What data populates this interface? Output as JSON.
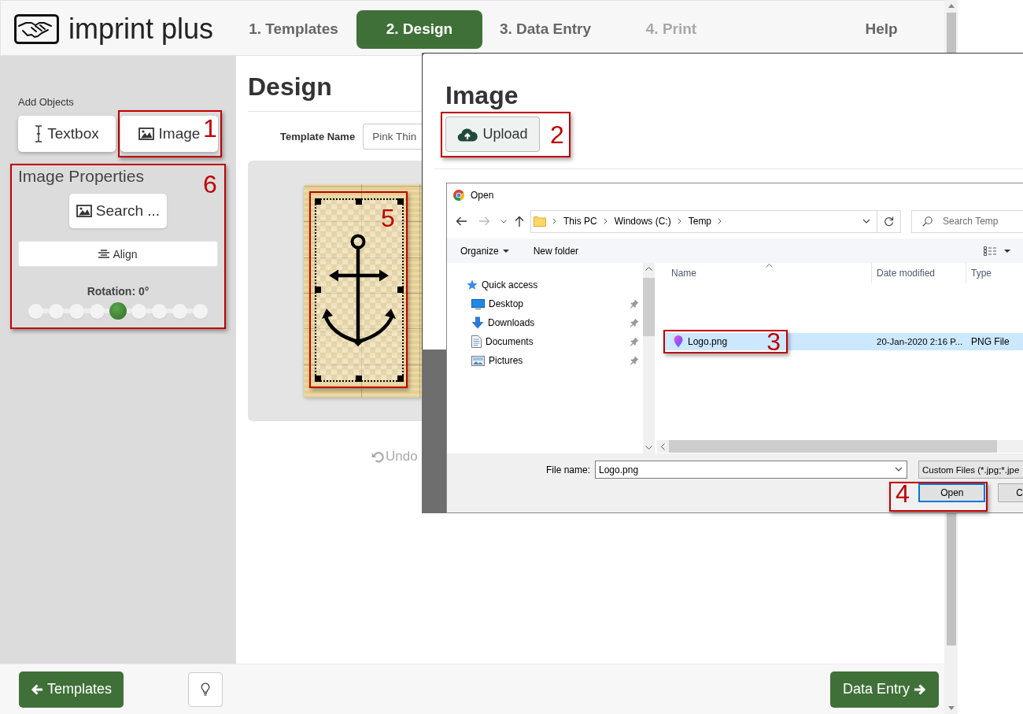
{
  "header": {
    "logo": "imprint plus",
    "steps": [
      {
        "label": "1. Templates",
        "selected": false,
        "disabled": false
      },
      {
        "label": "2. Design",
        "selected": true,
        "disabled": false
      },
      {
        "label": "3. Data Entry",
        "selected": false,
        "disabled": false
      },
      {
        "label": "4. Print",
        "selected": false,
        "disabled": true
      }
    ],
    "help": "Help"
  },
  "sidebar": {
    "add_objects": {
      "label": "Add Objects",
      "buttons": [
        {
          "kind": "textbox",
          "label": "Textbox"
        },
        {
          "kind": "image",
          "label": "Image",
          "callout": "1"
        }
      ]
    },
    "image_properties": {
      "title": "Image Properties",
      "callout": "6",
      "search_button": "Search ...",
      "align_button": "Align",
      "rotation": {
        "label": "Rotation: 0°",
        "level": 0.5
      }
    }
  },
  "main": {
    "title": "Design",
    "template_name": {
      "label": "Template Name",
      "value": "Pink Thin"
    },
    "canvas": {
      "image": {
        "selected": true,
        "callout": "5"
      }
    },
    "undo": "Undo"
  },
  "image_dialog": {
    "title": "Image",
    "upload": {
      "label": "Upload",
      "callout": "2"
    }
  },
  "open_dialog": {
    "title": "Open",
    "path": [
      "This PC",
      "Windows (C:)",
      "Temp"
    ],
    "search_placeholder": "Search Temp",
    "organize": "Organize",
    "new_folder": "New folder",
    "nav": [
      {
        "kind": "quick-access",
        "label": "Quick access",
        "pinned": false
      },
      {
        "kind": "desktop",
        "label": "Desktop",
        "pinned": true
      },
      {
        "kind": "downloads",
        "label": "Downloads",
        "pinned": true
      },
      {
        "kind": "documents",
        "label": "Documents",
        "pinned": true
      },
      {
        "kind": "pictures",
        "label": "Pictures",
        "pinned": true
      }
    ],
    "columns": [
      "Name",
      "Date modified",
      "Type"
    ],
    "files": [
      {
        "name": "Logo.png",
        "date": "20-Jan-2020 2:16 P...",
        "type": "PNG File",
        "selected": true,
        "callout": "3"
      }
    ],
    "file_name_label": "File name:",
    "file_name": "Logo.png",
    "filter": "Custom Files (*.jpg;*.jpe",
    "buttons": [
      {
        "label": "Open",
        "default": true,
        "callout": "4"
      },
      {
        "label": "C",
        "default": false
      }
    ]
  },
  "footer": {
    "back": "Templates",
    "next": "Data Entry"
  }
}
